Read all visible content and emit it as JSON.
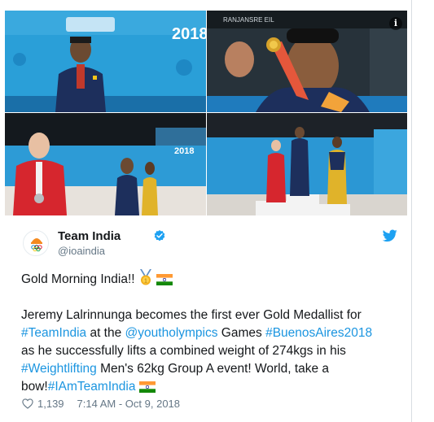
{
  "tweet": {
    "author": {
      "name": "Team India",
      "handle": "@ioaindia"
    },
    "text": {
      "greeting": "Gold Morning India!!",
      "p2": {
        "l1": "Jeremy Lalrinnunga becomes the first ever Gold Medallist for",
        "l2_tag1": "#TeamIndia",
        "l2_mid": " at the ",
        "l2_mention": "@youtholympics",
        "l2_after": " Games ",
        "l2_tag2": "#BuenosAires2018",
        "l3": "as he successfully lifts a combined weight of 274kgs in his",
        "l4_tag": "#Weightlifting",
        "l4_after": " Men's 62kg Group A event! World, take a",
        "l5_start": "bow!",
        "l5_tag": "#IAmTeamIndia"
      }
    },
    "likes": "1,139",
    "timestamp": "7:14 AM - Oct 9, 2018"
  },
  "media": {
    "photo1_sign": "2018",
    "photo2_board": "RANJANSRE  EIL",
    "photo3_sign": "2018"
  },
  "icons": {
    "info": "i",
    "verified": "verified-badge-icon",
    "bird": "twitter-bird-icon",
    "heart": "heart-icon",
    "medal": "gold-medal-emoji",
    "flag": "india-flag-emoji"
  },
  "colors": {
    "link": "#1b95e0",
    "secondary_text": "#657786",
    "verified": "#1da1f2"
  }
}
